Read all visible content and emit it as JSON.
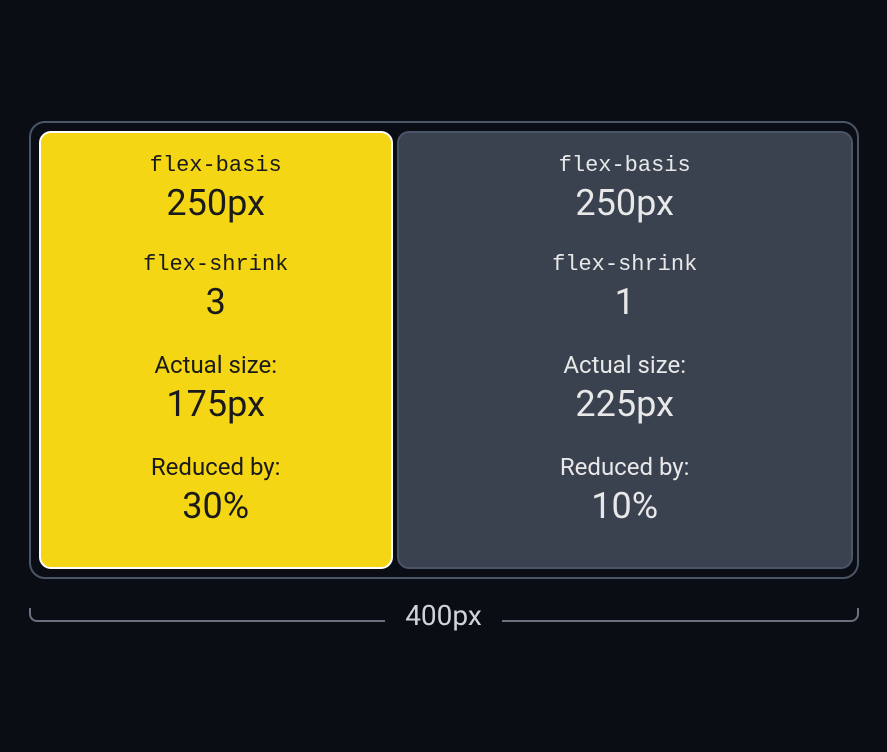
{
  "container": {
    "width_label": "400px"
  },
  "items": [
    {
      "flex_basis_label": "flex-basis",
      "flex_basis_value": "250px",
      "flex_shrink_label": "flex-shrink",
      "flex_shrink_value": "3",
      "actual_size_label": "Actual size:",
      "actual_size_value": "175px",
      "reduced_by_label": "Reduced by:",
      "reduced_by_value": "30%"
    },
    {
      "flex_basis_label": "flex-basis",
      "flex_basis_value": "250px",
      "flex_shrink_label": "flex-shrink",
      "flex_shrink_value": "1",
      "actual_size_label": "Actual size:",
      "actual_size_value": "225px",
      "reduced_by_label": "Reduced by:",
      "reduced_by_value": "10%"
    }
  ]
}
